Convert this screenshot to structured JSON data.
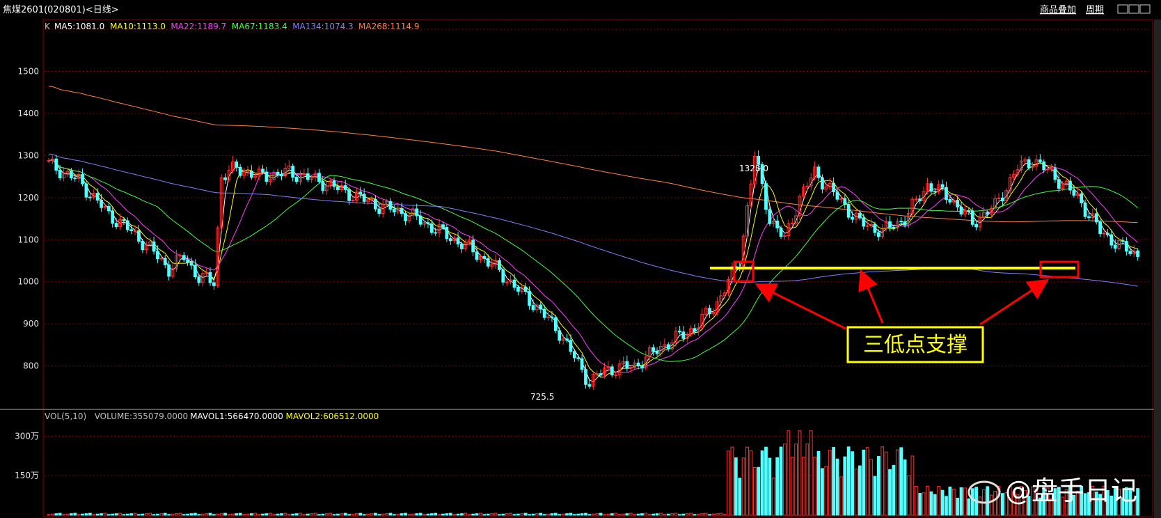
{
  "window": {
    "title": "焦煤2601(020801)<日线>",
    "right_buttons": [
      "商品叠加",
      "周期"
    ]
  },
  "price_panel": {
    "indicator_prefix": "K",
    "ma_labels": [
      {
        "text": "MA5:1081.0",
        "color": "#ffffff"
      },
      {
        "text": "MA10:1113.0",
        "color": "#ffff00"
      },
      {
        "text": "MA22:1189.7",
        "color": "#ff40ff"
      },
      {
        "text": "MA67:1183.4",
        "color": "#40ff40"
      },
      {
        "text": "MA134:1074.3",
        "color": "#8080ff"
      },
      {
        "text": "MA268:1114.9",
        "color": "#ff8040"
      }
    ],
    "y_ticks": [
      "1500",
      "1400",
      "1300",
      "1200",
      "1100",
      "1000",
      "900",
      "800"
    ],
    "high_label": "1328.0",
    "low_label": "725.5",
    "annotation": "三低点支撑"
  },
  "volume_panel": {
    "labels": [
      {
        "text": "VOL(5,10)",
        "color": "#c0c0c0"
      },
      {
        "text": "VOLUME:355079.0000",
        "color": "#c0c0c0"
      },
      {
        "text": "MAVOL1:566470.0000",
        "color": "#ffffff"
      },
      {
        "text": "MAVOL2:606512.0000",
        "color": "#ffff00"
      }
    ],
    "y_ticks": [
      "300万",
      "150万"
    ]
  },
  "watermark": "@盘手日记",
  "colors": {
    "up": "#ff3232",
    "down": "#54ffff",
    "grid": "#8b0000",
    "support_line": "#ffff00",
    "annotation_box": "#ff0000"
  },
  "chart_data": {
    "type": "candlestick",
    "series_labels": [
      "MA5",
      "MA10",
      "MA22",
      "MA67",
      "MA134",
      "MA268"
    ],
    "y_range": [
      700,
      1620
    ],
    "key_points": {
      "high": 1328.0,
      "low": 725.5
    },
    "close_path": [
      [
        0,
        1280
      ],
      [
        8,
        1240
      ],
      [
        16,
        1160
      ],
      [
        22,
        1120
      ],
      [
        28,
        1070
      ],
      [
        32,
        1030
      ],
      [
        36,
        1060
      ],
      [
        40,
        1010
      ],
      [
        44,
        1000
      ],
      [
        46,
        1250
      ],
      [
        50,
        1270
      ],
      [
        56,
        1250
      ],
      [
        64,
        1260
      ],
      [
        72,
        1240
      ],
      [
        80,
        1210
      ],
      [
        88,
        1180
      ],
      [
        96,
        1160
      ],
      [
        104,
        1120
      ],
      [
        112,
        1080
      ],
      [
        118,
        1040
      ],
      [
        124,
        990
      ],
      [
        130,
        940
      ],
      [
        136,
        880
      ],
      [
        140,
        820
      ],
      [
        144,
        760
      ],
      [
        148,
        790
      ],
      [
        156,
        800
      ],
      [
        164,
        850
      ],
      [
        172,
        890
      ],
      [
        178,
        950
      ],
      [
        184,
        1050
      ],
      [
        188,
        1300
      ],
      [
        192,
        1150
      ],
      [
        196,
        1100
      ],
      [
        200,
        1200
      ],
      [
        204,
        1260
      ],
      [
        210,
        1200
      ],
      [
        216,
        1140
      ],
      [
        222,
        1120
      ],
      [
        228,
        1150
      ],
      [
        234,
        1230
      ],
      [
        240,
        1200
      ],
      [
        246,
        1140
      ],
      [
        252,
        1180
      ],
      [
        258,
        1270
      ],
      [
        262,
        1290
      ],
      [
        268,
        1250
      ],
      [
        274,
        1200
      ],
      [
        280,
        1120
      ],
      [
        286,
        1080
      ],
      [
        290,
        1065
      ]
    ],
    "support_level": 1065
  }
}
